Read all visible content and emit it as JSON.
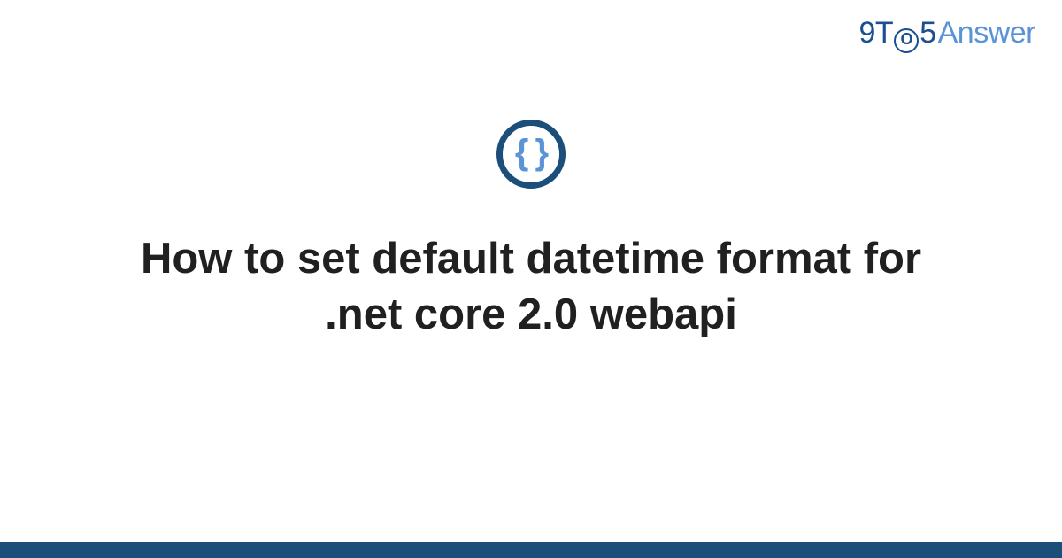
{
  "brand": {
    "part1": "9",
    "part2": "T",
    "clock_label": "O",
    "part3": "5",
    "part4": "Answer"
  },
  "category_icon": {
    "name": "code-braces-icon",
    "glyph": "{ }"
  },
  "title": "How to set default datetime format for .net core 2.0 webapi",
  "colors": {
    "brand_dark": "#1b4f7a",
    "brand_blue": "#1b4f91",
    "brand_light": "#5a94d6",
    "text": "#202020"
  }
}
